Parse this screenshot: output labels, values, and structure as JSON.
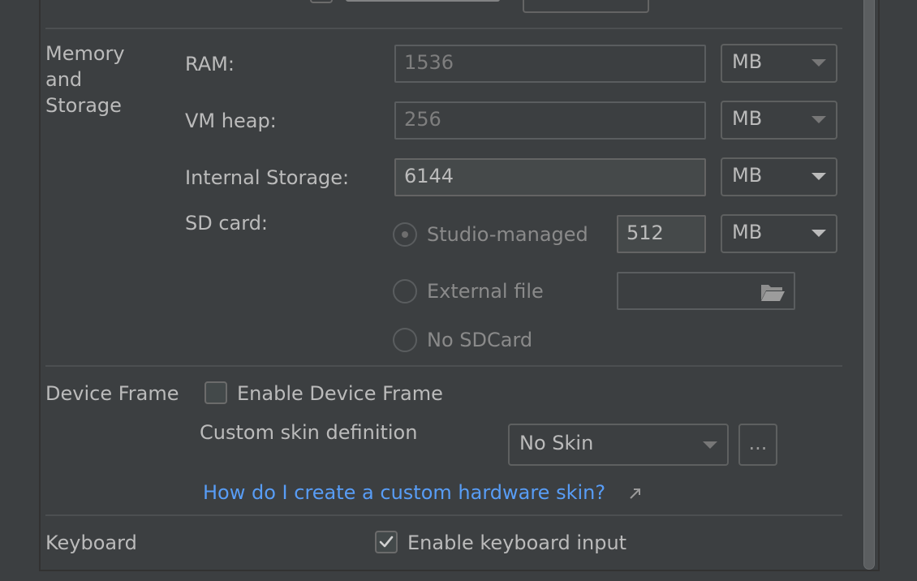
{
  "sections": {
    "memory": {
      "title": "Memory\nand\nStorage",
      "ram": {
        "label": "RAM:",
        "value": "1536",
        "unit": "MB"
      },
      "vm_heap": {
        "label": "VM heap:",
        "value": "256",
        "unit": "MB"
      },
      "internal_storage": {
        "label": "Internal Storage:",
        "value": "6144",
        "unit": "MB"
      },
      "sd_card": {
        "label": "SD card:",
        "studio_managed_label": "Studio-managed",
        "studio_managed_value": "512",
        "studio_managed_unit": "MB",
        "external_file_label": "External file",
        "no_sdcard_label": "No SDCard"
      }
    },
    "device_frame": {
      "title": "Device Frame",
      "enable_label": "Enable Device Frame",
      "custom_skin_label": "Custom skin definition",
      "skin_value": "No Skin",
      "more_button": "...",
      "help_link": "How do I create a custom hardware skin?"
    },
    "keyboard": {
      "title": "Keyboard",
      "enable_label": "Enable keyboard input"
    }
  },
  "icons": {
    "folder": "folder-open-icon",
    "external_link": "arrow-up-right-icon",
    "checkmark": "checkmark-icon"
  },
  "colors": {
    "background": "#3c3f41",
    "link": "#589df6",
    "text": "#bbbbbb"
  }
}
